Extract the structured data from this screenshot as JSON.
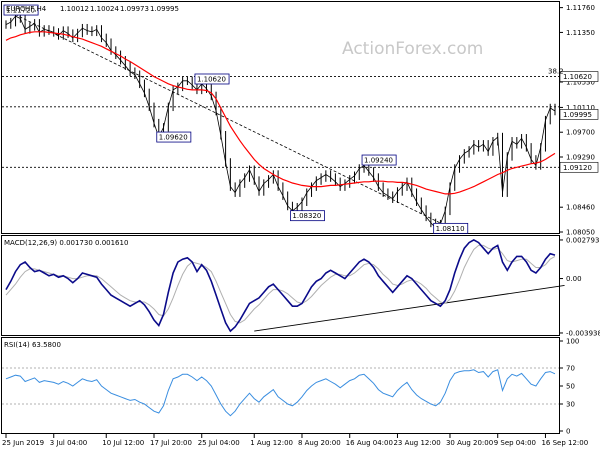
{
  "watermark": "ActionForex.com",
  "chart_data": {
    "type": "line",
    "symbol_header": "EURCHF,H4",
    "ohlc": [
      "1.10012",
      "1.10024",
      "1.09973",
      "1.09995"
    ],
    "colors": {
      "price": "#000000",
      "ma": "#ff0000",
      "macd": "#0b0b8a",
      "signal": "#b0b0b0",
      "rsi": "#3a8ee0",
      "trendline": "#000000",
      "label_border": "#000080",
      "last_price_bg": "#ffffff"
    },
    "x_tick_labels": [
      "25 Jun 2019",
      "3 Jul 04:00",
      "10 Jul 12:00",
      "17 Jul 20:00",
      "25 Jul 04:00",
      "1 Aug 12:00",
      "8 Aug 20:00",
      "16 Aug 04:00",
      "23 Aug 12:00",
      "30 Aug 20:00",
      "9 Sep 04:00",
      "16 Sep 12:00"
    ],
    "x_tick_index": [
      0,
      10,
      21,
      31,
      41,
      52,
      62,
      72,
      82,
      93,
      103,
      113
    ],
    "price_panel": {
      "ylim": [
        1.0805,
        1.1182
      ],
      "y_ticks": [
        "1.11760",
        "1.11350",
        "1.10530",
        "1.10110",
        "1.09700",
        "1.09290",
        "1.08460",
        "1.08050"
      ],
      "close": [
        1.1148,
        1.1152,
        1.1162,
        1.1158,
        1.114,
        1.1145,
        1.115,
        1.1135,
        1.114,
        1.1138,
        1.1135,
        1.113,
        1.1138,
        1.1133,
        1.1126,
        1.1134,
        1.1142,
        1.1138,
        1.1136,
        1.114,
        1.1126,
        1.1118,
        1.1105,
        1.1098,
        1.1089,
        1.108,
        1.107,
        1.1065,
        1.105,
        1.1035,
        1.1012,
        1.0985,
        1.0962,
        1.0978,
        1.1012,
        1.104,
        1.1045,
        1.1055,
        1.1055,
        1.1048,
        1.104,
        1.105,
        1.1042,
        1.103,
        1.1005,
        1.0965,
        1.092,
        1.088,
        1.087,
        1.0885,
        1.0895,
        1.0908,
        1.089,
        1.0872,
        1.0885,
        1.0892,
        1.09,
        1.088,
        1.0865,
        1.0848,
        1.084,
        1.0846,
        1.0855,
        1.087,
        1.088,
        1.089,
        1.0895,
        1.09,
        1.0895,
        1.0888,
        1.088,
        1.0885,
        1.0892,
        1.0898,
        1.091,
        1.0915,
        1.0905,
        1.0895,
        1.088,
        1.087,
        1.0865,
        1.086,
        1.0872,
        1.088,
        1.0888,
        1.087,
        1.0855,
        1.0842,
        1.083,
        1.082,
        1.0812,
        1.0818,
        1.084,
        1.088,
        1.091,
        1.0925,
        1.0935,
        1.094,
        1.095,
        1.0945,
        1.095,
        1.0938,
        1.0955,
        1.0962,
        1.087,
        1.093,
        1.0955,
        1.095,
        1.096,
        1.0945,
        1.0925,
        1.0915,
        1.0945,
        1.099,
        1.101,
        1.1005
      ],
      "ma": [
        1.1122,
        1.1126,
        1.1128,
        1.1131,
        1.1133,
        1.1135,
        1.1136,
        1.1136,
        1.1136,
        1.1135,
        1.1134,
        1.1133,
        1.1132,
        1.113,
        1.1128,
        1.1126,
        1.1124,
        1.1121,
        1.1118,
        1.1115,
        1.1112,
        1.1108,
        1.1104,
        1.11,
        1.1096,
        1.1091,
        1.1087,
        1.1082,
        1.1077,
        1.1072,
        1.1067,
        1.1062,
        1.1058,
        1.1054,
        1.105,
        1.1047,
        1.1045,
        1.1043,
        1.1041,
        1.104,
        1.104,
        1.104,
        1.1039,
        1.1035,
        1.1025,
        1.101,
        1.0995,
        1.098,
        1.0968,
        1.0956,
        1.0945,
        1.0935,
        1.0925,
        1.0917,
        1.091,
        1.0905,
        1.09,
        1.0896,
        1.0892,
        1.0889,
        1.0886,
        1.0884,
        1.0882,
        1.0881,
        1.088,
        1.088,
        1.088,
        1.0881,
        1.0882,
        1.0882,
        1.0883,
        1.0884,
        1.0885,
        1.0886,
        1.0887,
        1.0888,
        1.0888,
        1.0889,
        1.0889,
        1.0889,
        1.0888,
        1.0888,
        1.0887,
        1.0887,
        1.0886,
        1.0884,
        1.0882,
        1.0879,
        1.0876,
        1.0874,
        1.0872,
        1.087,
        1.0868,
        1.0868,
        1.0869,
        1.0871,
        1.0874,
        1.0877,
        1.088,
        1.0884,
        1.0888,
        1.0892,
        1.0896,
        1.09,
        1.0903,
        1.0907,
        1.091,
        1.0912,
        1.0914,
        1.0916,
        1.0918,
        1.0919,
        1.0921,
        1.0925,
        1.093,
        1.0935
      ],
      "hlines": [
        {
          "value": 1.1062,
          "label": "1.10620"
        },
        {
          "value": 1.1012,
          "label": ""
        },
        {
          "value": 1.0912,
          "label": "1.09120"
        }
      ],
      "fib_label": "38.2",
      "last_price": {
        "value": 1.09995,
        "label": "1.09995"
      },
      "trendline": {
        "x": [
          0,
          93
        ],
        "y": [
          1.1172,
          1.0812
        ]
      },
      "annotations": [
        {
          "text": "1.11720",
          "x": 0,
          "y": 1.1172
        },
        {
          "text": "1.10620",
          "x": 40,
          "y": 1.1058
        },
        {
          "text": "1.09620",
          "x": 32,
          "y": 1.0962
        },
        {
          "text": "1.08320",
          "x": 60,
          "y": 1.0832
        },
        {
          "text": "1.09240",
          "x": 75,
          "y": 1.0924
        },
        {
          "text": "1.08110",
          "x": 90,
          "y": 1.0811
        }
      ]
    },
    "macd_panel": {
      "title": "MACD(12,26,9) 0.001730 0.001610",
      "ylim": [
        -0.00394,
        0.00279
      ],
      "y_ticks": [
        "0.002793",
        "0.00",
        "-0.003938"
      ],
      "macd": [
        -0.0008,
        -0.0002,
        0.0005,
        0.001,
        0.0012,
        0.0008,
        0.0005,
        0.0006,
        0.0004,
        0.0002,
        0.0003,
        0.0001,
        0.0002,
        0.0,
        -0.0003,
        0.0,
        0.0004,
        0.0003,
        0.0002,
        0.0001,
        -0.0004,
        -0.0008,
        -0.0012,
        -0.0014,
        -0.0016,
        -0.0018,
        -0.002,
        -0.0018,
        -0.0016,
        -0.0019,
        -0.0024,
        -0.003,
        -0.0034,
        -0.0026,
        -0.001,
        0.0004,
        0.0012,
        0.0014,
        0.0015,
        0.0012,
        0.0005,
        0.001,
        0.0006,
        -0.0002,
        -0.0012,
        -0.0022,
        -0.0032,
        -0.0038,
        -0.0035,
        -0.003,
        -0.0024,
        -0.0018,
        -0.0016,
        -0.0014,
        -0.001,
        -0.0006,
        -0.0004,
        -0.0008,
        -0.0012,
        -0.0016,
        -0.002,
        -0.002,
        -0.0018,
        -0.0012,
        -0.0006,
        -0.0002,
        0.0,
        0.0004,
        0.0006,
        0.0004,
        0.0002,
        0.0,
        0.0004,
        0.0008,
        0.0012,
        0.0014,
        0.0012,
        0.0008,
        0.0002,
        -0.0002,
        -0.0006,
        -0.001,
        -0.0006,
        -0.0002,
        0.0002,
        0.0,
        -0.0004,
        -0.0008,
        -0.0012,
        -0.0016,
        -0.0018,
        -0.002,
        -0.0016,
        -0.0008,
        0.0004,
        0.0014,
        0.0022,
        0.0026,
        0.0028,
        0.0026,
        0.0022,
        0.0018,
        0.0022,
        0.0024,
        0.0012,
        0.0006,
        0.0012,
        0.0016,
        0.0016,
        0.0012,
        0.0006,
        0.0004,
        0.0008,
        0.0014,
        0.0018,
        0.0017
      ],
      "signal": [
        -0.0012,
        -0.0008,
        -0.0004,
        0.0001,
        0.0005,
        0.0007,
        0.0007,
        0.0006,
        0.0005,
        0.0004,
        0.0003,
        0.0002,
        0.0002,
        0.0001,
        0.0,
        0.0,
        0.0001,
        0.0002,
        0.0002,
        0.0002,
        0.0,
        -0.0003,
        -0.0006,
        -0.0009,
        -0.0012,
        -0.0014,
        -0.0016,
        -0.0017,
        -0.0017,
        -0.0017,
        -0.0019,
        -0.0022,
        -0.0026,
        -0.0027,
        -0.0022,
        -0.0014,
        -0.0005,
        0.0003,
        0.0009,
        0.0012,
        0.0011,
        0.001,
        0.0008,
        0.0005,
        -0.0002,
        -0.001,
        -0.0018,
        -0.0026,
        -0.0031,
        -0.0032,
        -0.003,
        -0.0026,
        -0.0022,
        -0.0019,
        -0.0015,
        -0.0011,
        -0.0008,
        -0.0008,
        -0.0009,
        -0.0011,
        -0.0014,
        -0.0017,
        -0.0018,
        -0.0016,
        -0.0013,
        -0.0009,
        -0.0005,
        -0.0002,
        0.0001,
        0.0003,
        0.0003,
        0.0002,
        0.0002,
        0.0004,
        0.0007,
        0.001,
        0.0011,
        0.001,
        0.0007,
        0.0003,
        0.0,
        -0.0004,
        -0.0005,
        -0.0004,
        -0.0002,
        -0.0001,
        -0.0002,
        -0.0004,
        -0.0007,
        -0.0011,
        -0.0014,
        -0.0017,
        -0.0018,
        -0.0015,
        -0.0009,
        -0.0001,
        0.0008,
        0.0015,
        0.0021,
        0.0024,
        0.0024,
        0.0022,
        0.0021,
        0.0022,
        0.0018,
        0.0013,
        0.0012,
        0.0013,
        0.0014,
        0.0014,
        0.0011,
        0.0008,
        0.0008,
        0.001,
        0.0014,
        0.0016
      ],
      "trendline": {
        "x": [
          52,
          117
        ],
        "y": [
          -0.0038,
          -0.0005
        ]
      }
    },
    "rsi_panel": {
      "title": "RSI(14) 63.5800",
      "ylim": [
        0,
        100
      ],
      "y_ticks": [
        "100",
        "70",
        "50",
        "30",
        "0"
      ],
      "levels": [
        70,
        30
      ],
      "values": [
        58,
        60,
        62,
        61,
        55,
        57,
        59,
        54,
        56,
        55,
        54,
        52,
        55,
        53,
        50,
        54,
        58,
        56,
        55,
        57,
        50,
        46,
        42,
        40,
        38,
        36,
        34,
        35,
        32,
        30,
        26,
        22,
        20,
        28,
        45,
        58,
        60,
        63,
        63,
        60,
        56,
        60,
        56,
        50,
        40,
        30,
        22,
        17,
        22,
        30,
        36,
        42,
        36,
        32,
        38,
        42,
        46,
        38,
        34,
        30,
        28,
        32,
        38,
        45,
        50,
        54,
        56,
        58,
        55,
        52,
        48,
        52,
        56,
        58,
        62,
        63,
        58,
        53,
        46,
        42,
        40,
        38,
        45,
        50,
        54,
        46,
        40,
        36,
        33,
        30,
        28,
        32,
        42,
        56,
        64,
        66,
        67,
        67,
        68,
        65,
        66,
        60,
        66,
        68,
        45,
        58,
        63,
        61,
        64,
        58,
        52,
        50,
        58,
        65,
        66,
        63.58
      ]
    }
  }
}
